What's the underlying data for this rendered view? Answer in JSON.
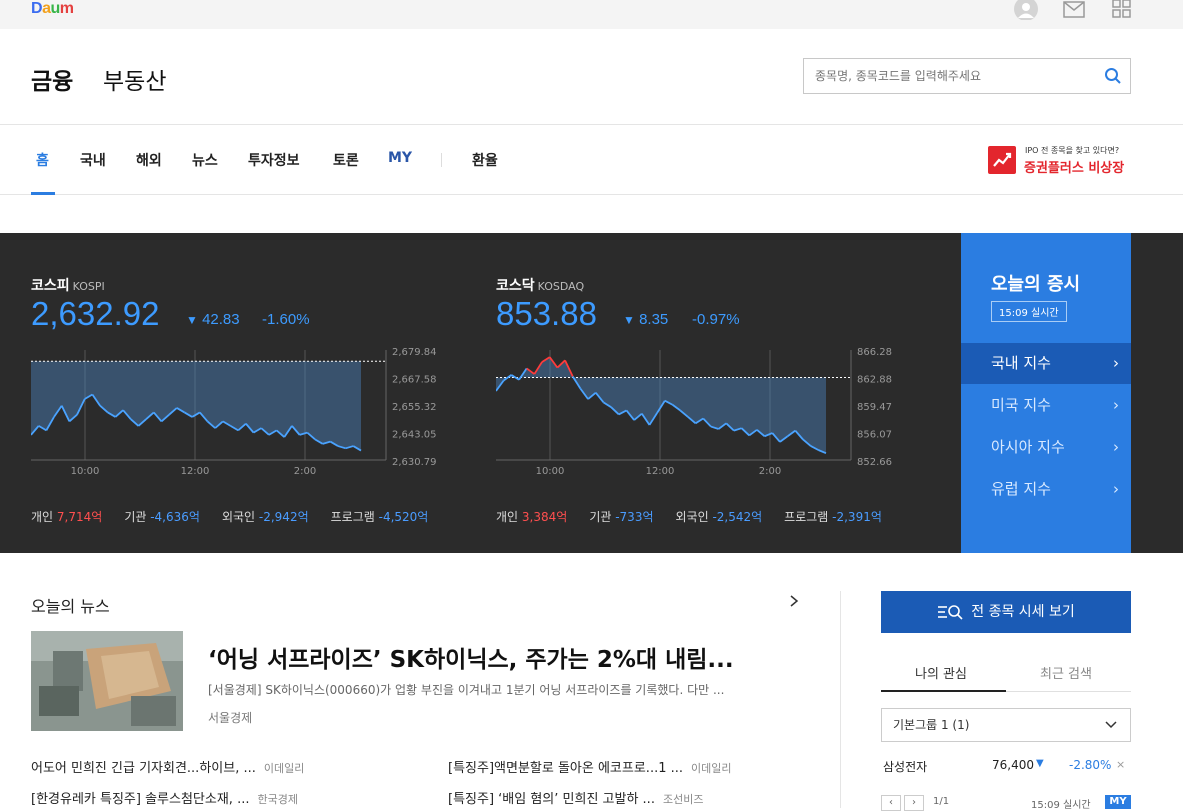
{
  "brand": {
    "logo_letters": [
      "D",
      "a",
      "u",
      "m"
    ]
  },
  "header": {
    "title_finance": "금융",
    "title_realestate": "부동산",
    "search_placeholder": "종목명, 종목코드를 입력해주세요"
  },
  "nav": {
    "items": [
      "홈",
      "국내",
      "해외",
      "뉴스",
      "투자정보",
      "토론",
      "MY",
      "환율"
    ],
    "ad_sub": "IPO 전 종목을 찾고 있다면?",
    "ad_main": "증권플러스 비상장"
  },
  "kospi": {
    "name": "코스피",
    "code": "KOSPI",
    "value": "2,632.92",
    "change": "42.83",
    "change_pct": "-1.60%",
    "y_ticks": [
      "2,679.84",
      "2,667.58",
      "2,655.32",
      "2,643.05",
      "2,630.79"
    ],
    "x_ticks": [
      "10:00",
      "12:00",
      "2:00"
    ],
    "investors": [
      {
        "label": "개인",
        "value": "7,714억",
        "sign": "pos"
      },
      {
        "label": "기관",
        "value": "-4,636억",
        "sign": "neg"
      },
      {
        "label": "외국인",
        "value": "-2,942억",
        "sign": "neg"
      },
      {
        "label": "프로그램",
        "value": "-4,520억",
        "sign": "neg"
      }
    ]
  },
  "kosdaq": {
    "name": "코스닥",
    "code": "KOSDAQ",
    "value": "853.88",
    "change": "8.35",
    "change_pct": "-0.97%",
    "y_ticks": [
      "866.28",
      "862.88",
      "859.47",
      "856.07",
      "852.66"
    ],
    "x_ticks": [
      "10:00",
      "12:00",
      "2:00"
    ],
    "investors": [
      {
        "label": "개인",
        "value": "3,384억",
        "sign": "pos"
      },
      {
        "label": "기관",
        "value": "-733억",
        "sign": "neg"
      },
      {
        "label": "외국인",
        "value": "-2,542억",
        "sign": "neg"
      },
      {
        "label": "프로그램",
        "value": "-2,391억",
        "sign": "neg"
      }
    ]
  },
  "today": {
    "title": "오늘의 증시",
    "badge": "15:09 실시간",
    "items": [
      "국내 지수",
      "미국 지수",
      "아시아 지수",
      "유럽 지수"
    ]
  },
  "news": {
    "section_title": "오늘의 뉴스",
    "headline": "‘어닝 서프라이즈’ SK하이닉스, 주가는 2%대 내림...",
    "summary": "[서울경제] SK하이닉스(000660)가 업황 부진을 이겨내고 1분기 어닝 서프라이즈를 기록했다. 다만 ...",
    "source": "서울경제",
    "items": [
      {
        "title": "어도어 민희진 긴급 기자회견...하이브, ...",
        "src": "이데일리"
      },
      {
        "title": "[특징주]액면분할로 돌아온 에코프로...1 ...",
        "src": "이데일리"
      },
      {
        "title": "[한경유레카 특징주] 솔루스첨단소재, ...",
        "src": "한국경제"
      },
      {
        "title": "[특징주] ‘배임 혐의’ 민희진 고발하 ...",
        "src": "조선비즈"
      }
    ]
  },
  "side": {
    "all_button": "전 종목 시세 보기",
    "tab_mine": "나의 관심",
    "tab_recent": "최근 검색",
    "group_select": "기본그룹 1 (1)",
    "watch": {
      "name": "삼성전자",
      "price": "76,400",
      "pct": "-2.80%"
    },
    "pager_text": "1/1",
    "realtime": "15:09 실시간",
    "my_label": "MY"
  },
  "chart_data": [
    {
      "type": "area",
      "title": "코스피",
      "x_ticks": [
        "10:00",
        "12:00",
        "2:00"
      ],
      "ylim": [
        2630.79,
        2679.84
      ],
      "reference": 2674.8,
      "values": [
        2642,
        2646,
        2644,
        2650,
        2655,
        2648,
        2651,
        2658,
        2660,
        2655,
        2652,
        2650,
        2653,
        2649,
        2646,
        2649,
        2652,
        2648,
        2651,
        2654,
        2652,
        2650,
        2652,
        2648,
        2645,
        2648,
        2646,
        2644,
        2647,
        2643,
        2645,
        2642,
        2644,
        2641,
        2646,
        2642,
        2643,
        2640,
        2638,
        2639,
        2637,
        2636,
        2637,
        2635
      ]
    },
    {
      "type": "area",
      "title": "코스닥",
      "x_ticks": [
        "10:00",
        "12:00",
        "2:00"
      ],
      "ylim": [
        852.66,
        866.28
      ],
      "reference": 862.88,
      "values": [
        861.2,
        862.5,
        863.2,
        862.6,
        864.0,
        863.3,
        864.8,
        865.4,
        864.1,
        865.0,
        863.0,
        861.5,
        860.2,
        861.0,
        859.8,
        859.2,
        858.3,
        858.8,
        857.6,
        858.4,
        857.0,
        858.5,
        860.0,
        859.5,
        858.8,
        858.0,
        857.2,
        857.8,
        856.8,
        856.5,
        857.2,
        856.3,
        856.6,
        855.7,
        856.4,
        855.6,
        856.0,
        854.9,
        855.6,
        856.3,
        855.2,
        854.4,
        853.9,
        853.5
      ]
    }
  ]
}
